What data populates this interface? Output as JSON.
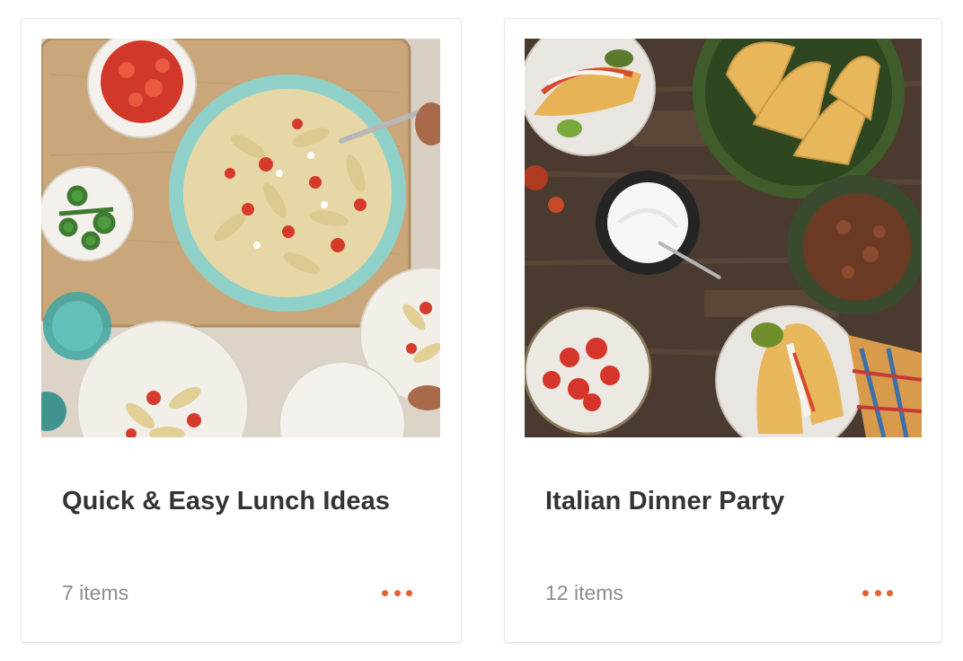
{
  "accent_color": "#e8612e",
  "collections": [
    {
      "title": "Quick & Easy Lunch Ideas",
      "count_label": "7 items",
      "image": "pasta-salad-photo",
      "menu_icon": "more-horizontal-icon"
    },
    {
      "title": "Italian Dinner Party",
      "count_label": "12 items",
      "image": "tacos-spread-photo",
      "menu_icon": "more-horizontal-icon"
    }
  ]
}
